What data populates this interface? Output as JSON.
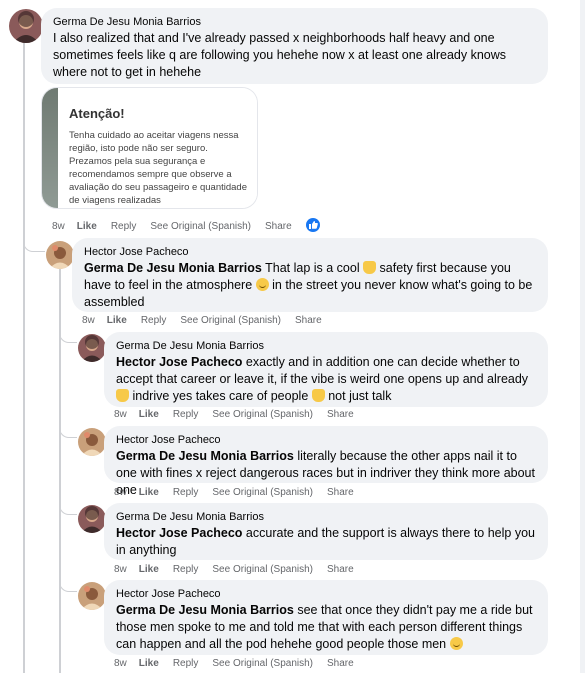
{
  "comments": [
    {
      "author": "Germa De Jesu Monia Barrios",
      "mention": "",
      "text": "I also realized that and I've already passed x neighborhoods half heavy and one sometimes feels like q are following you hehehe now x at least one already knows where not to get in hehehe",
      "time": "8w",
      "like": "Like",
      "reply": "Reply",
      "see_original": "See Original (Spanish)",
      "share": "Share"
    },
    {
      "author": "Hector Jose Pacheco",
      "mention": "Germa De Jesu Monia Barrios",
      "text_a": " That lap is a cool ",
      "text_b": " safety first because you have to feel in the atmosphere ",
      "text_c": " in the street you never know what's going to be assembled",
      "time": "8w",
      "like": "Like",
      "reply": "Reply",
      "see_original": "See Original (Spanish)",
      "share": "Share"
    },
    {
      "author": "Germa De Jesu Monia Barrios",
      "mention": "Hector Jose Pacheco",
      "text_a": " exactly and in addition one can decide whether to accept that career or leave it, if the vibe is weird one opens up and already ",
      "text_b": " indrive yes takes care of people ",
      "text_c": " not just talk",
      "time": "8w",
      "like": "Like",
      "reply": "Reply",
      "see_original": "See Original (Spanish)",
      "share": "Share"
    },
    {
      "author": "Hector Jose Pacheco",
      "mention": "Germa De Jesu Monia Barrios",
      "text": " literally because the other apps nail it to one with fines x reject dangerous races but in indriver they think more about one",
      "time": "8w",
      "like": "Like",
      "reply": "Reply",
      "see_original": "See Original (Spanish)",
      "share": "Share"
    },
    {
      "author": "Germa De Jesu Monia Barrios",
      "mention": "Hector Jose Pacheco",
      "text": " accurate and the support is always there to help you in anything",
      "time": "8w",
      "like": "Like",
      "reply": "Reply",
      "see_original": "See Original (Spanish)",
      "share": "Share"
    },
    {
      "author": "Hector Jose Pacheco",
      "mention": "Germa De Jesu Monia Barrios",
      "text": " see that once they didn't pay me a ride but those men spoke to me and told me that with each person different things can happen and all the pod hehehe good people those men ",
      "time": "8w",
      "like": "Like",
      "reply": "Reply",
      "see_original": "See Original (Spanish)",
      "share": "Share"
    }
  ],
  "attachment": {
    "title": "Atenção!",
    "body": "Tenha cuidado ao aceitar viagens nessa região, isto pode não ser seguro. Prezamos pela sua segurança e recomendamos sempre que observe a avaliação do seu passageiro e quantidade de viagens realizadas"
  },
  "icons": {
    "like_reaction": "thumbs-up-icon",
    "emoji_hands": "raising-hands-emoji",
    "emoji_smile": "smiling-face-emoji",
    "emoji_thumb": "thumbs-up-emoji"
  },
  "colors": {
    "bubble": "#f0f2f5",
    "meta_text": "#65676b",
    "like_blue": "#1877f2",
    "thread_line": "#ced0d4"
  }
}
